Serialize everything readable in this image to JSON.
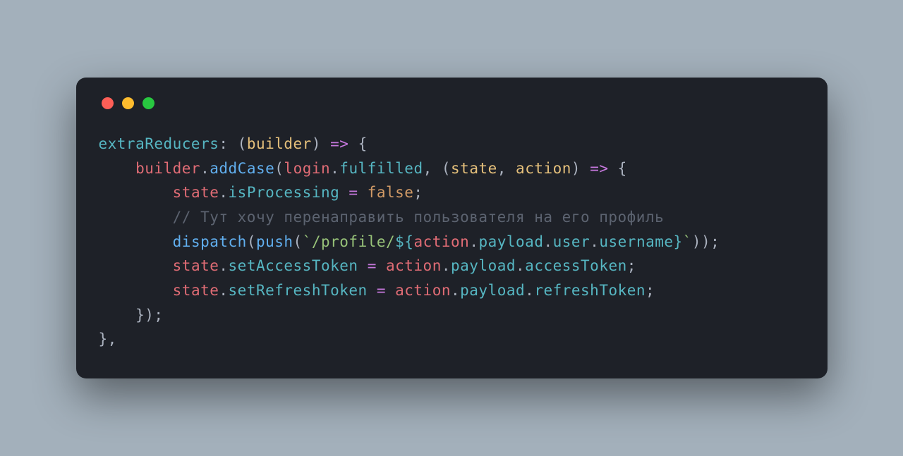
{
  "window": {
    "controls": {
      "close": "close",
      "minimize": "minimize",
      "maximize": "maximize"
    }
  },
  "code": {
    "line1": {
      "key": "extraReducers",
      "colon": ": (",
      "param": "builder",
      "close_paren": ") ",
      "arrow": "=>",
      "brace": " {"
    },
    "line2": {
      "indent": "    ",
      "builder": "builder",
      "dot": ".",
      "addCase": "addCase",
      "open": "(",
      "login": "login",
      "dot2": ".",
      "fulfilled": "fulfilled",
      "comma": ", (",
      "state": "state",
      "comma2": ", ",
      "action": "action",
      "close": ") ",
      "arrow": "=>",
      "brace": " {"
    },
    "line3": {
      "indent": "        ",
      "state": "state",
      "dot": ".",
      "isProcessing": "isProcessing",
      "eq": " = ",
      "false": "false",
      "semi": ";"
    },
    "line4": {
      "indent": "        ",
      "comment": "// Тут хочу перенаправить пользователя на его профиль"
    },
    "line5": {
      "indent": "        ",
      "dispatch": "dispatch",
      "open": "(",
      "push": "push",
      "open2": "(",
      "backtick1": "`",
      "str1": "/profile/",
      "interp_open": "${",
      "action": "action",
      "dot1": ".",
      "payload": "payload",
      "dot2": ".",
      "user": "user",
      "dot3": ".",
      "username": "username",
      "interp_close": "}",
      "backtick2": "`",
      "close": "));"
    },
    "line6": {
      "indent": "        ",
      "state": "state",
      "dot": ".",
      "setAccessToken": "setAccessToken",
      "eq": " = ",
      "action": "action",
      "dot2": ".",
      "payload": "payload",
      "dot3": ".",
      "accessToken": "accessToken",
      "semi": ";"
    },
    "line7": {
      "indent": "        ",
      "state": "state",
      "dot": ".",
      "setRefreshToken": "setRefreshToken",
      "eq": " = ",
      "action": "action",
      "dot2": ".",
      "payload": "payload",
      "dot3": ".",
      "refreshToken": "refreshToken",
      "semi": ";"
    },
    "line8": {
      "indent": "    ",
      "close": "});"
    },
    "line9": {
      "close": "},"
    }
  }
}
